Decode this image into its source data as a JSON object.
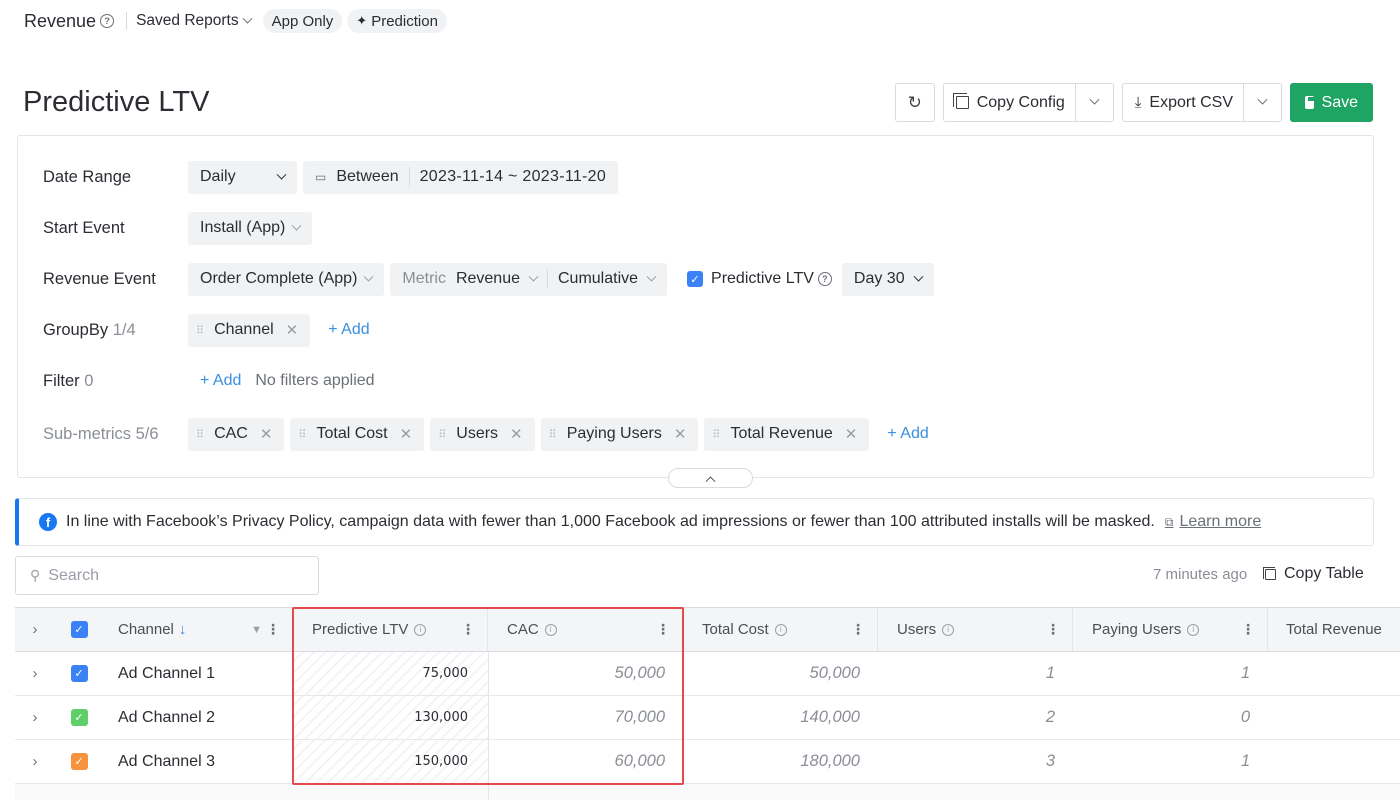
{
  "topnav": {
    "revenue": "Revenue",
    "saved_reports": "Saved Reports",
    "pills": [
      "App Only",
      "Prediction"
    ]
  },
  "page": {
    "title": "Predictive LTV"
  },
  "toolbar": {
    "copy_config": "Copy Config",
    "export_csv": "Export CSV",
    "save": "Save"
  },
  "config": {
    "date_range": {
      "label": "Date Range",
      "granularity": "Daily",
      "operator": "Between",
      "range": "2023-11-14 ~ 2023-11-20"
    },
    "start_event": {
      "label": "Start Event",
      "value": "Install (App)"
    },
    "revenue_event": {
      "label": "Revenue Event",
      "event": "Order Complete (App)",
      "metric_label": "Metric",
      "metric": "Revenue",
      "mode": "Cumulative",
      "predictive_label": "Predictive LTV",
      "predictive_checked": true,
      "day": "Day 30"
    },
    "groupby": {
      "label": "GroupBy",
      "count": "1/4",
      "chips": [
        "Channel"
      ],
      "add": "+ Add"
    },
    "filter": {
      "label": "Filter",
      "count": "0",
      "add": "+ Add",
      "empty": "No filters applied"
    },
    "submetrics": {
      "label": "Sub-metrics",
      "count": "5/6",
      "chips": [
        "CAC",
        "Total Cost",
        "Users",
        "Paying Users",
        "Total Revenue"
      ],
      "add": "+ Add"
    }
  },
  "notice": {
    "text": "In line with Facebook’s Privacy Policy, campaign data with fewer than 1,000 Facebook ad impressions or fewer than 100 attributed installs will be masked.",
    "link": "Learn more"
  },
  "search": {
    "placeholder": "Search"
  },
  "status": {
    "updated": "7 minutes ago",
    "copy_table": "Copy Table"
  },
  "table": {
    "columns": [
      "Channel",
      "Predictive LTV",
      "CAC",
      "Total Cost",
      "Users",
      "Paying Users",
      "Total Revenue"
    ],
    "rows": [
      {
        "channel": "Ad Channel 1",
        "color": "#3b82f6",
        "ltv": "75,000",
        "cac": "50,000",
        "cost": "50,000",
        "users": "1",
        "paying": "1"
      },
      {
        "channel": "Ad Channel 2",
        "color": "#5fd068",
        "ltv": "130,000",
        "cac": "70,000",
        "cost": "140,000",
        "users": "2",
        "paying": "0"
      },
      {
        "channel": "Ad Channel 3",
        "color": "#f7933e",
        "ltv": "150,000",
        "cac": "60,000",
        "cost": "180,000",
        "users": "3",
        "paying": "1"
      }
    ]
  },
  "colors": {
    "accent": "#3b8fe0",
    "save_green": "#1fa463",
    "highlight_red": "#e5484d",
    "facebook_blue": "#1877f2"
  }
}
